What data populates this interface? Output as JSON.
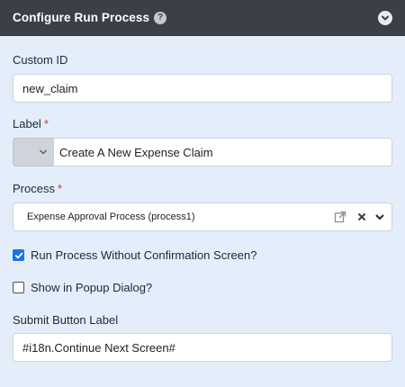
{
  "header": {
    "title": "Configure Run Process",
    "help_icon": "question-circle-icon",
    "collapse_icon": "chevron-down-circle-icon"
  },
  "fields": {
    "custom_id": {
      "label": "Custom ID",
      "value": "new_claim"
    },
    "label": {
      "label": "Label",
      "required_marker": "*",
      "value": "Create A New Expense Claim"
    },
    "process": {
      "label": "Process",
      "required_marker": "*",
      "value": "Expense Approval Process (process1)"
    },
    "run_without_confirmation": {
      "label": "Run Process Without Confirmation Screen?",
      "checked": true
    },
    "show_in_popup": {
      "label": "Show in Popup Dialog?",
      "checked": false
    },
    "submit_button_label": {
      "label": "Submit Button Label",
      "value": "#i18n.Continue Next Screen#"
    }
  },
  "colors": {
    "header_bg": "#3b4048",
    "panel_bg": "#e3eefa",
    "accent": "#1a73e8",
    "required": "#d33a2c"
  }
}
